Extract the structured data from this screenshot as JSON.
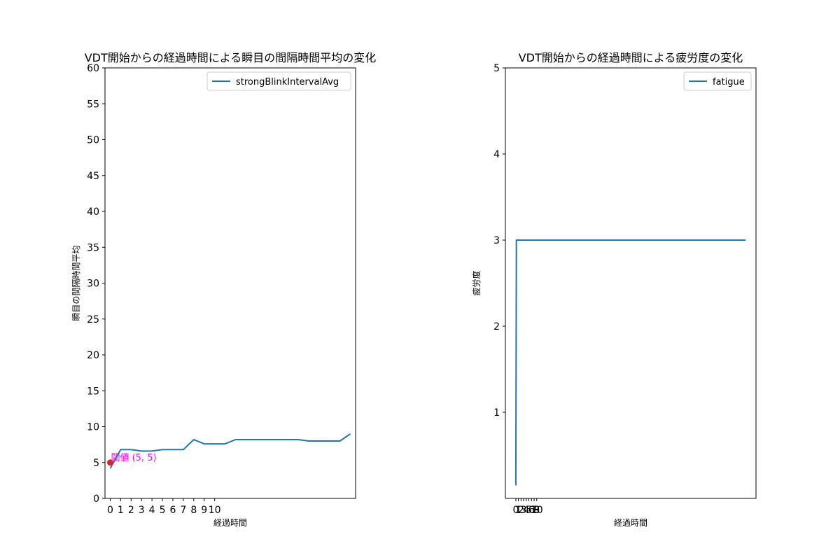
{
  "chart_data": [
    {
      "type": "line",
      "title": "VDT開始からの経過時間による瞬目の間隔時間平均の変化",
      "xlabel": "経過時間",
      "ylabel": "瞬目の間隔時間平均",
      "xlim": [
        -0.5,
        23.5
      ],
      "ylim": [
        0,
        60
      ],
      "yticks": [
        0,
        5,
        10,
        15,
        20,
        25,
        30,
        35,
        40,
        45,
        50,
        55,
        60
      ],
      "xticks": [
        0,
        1,
        2,
        3,
        4,
        5,
        6,
        7,
        8,
        9,
        10
      ],
      "xtick_labels": [
        "0",
        "1",
        "2",
        "3",
        "4",
        "5",
        "6",
        "7",
        "8",
        "9",
        "10"
      ],
      "legend_position": "top-right",
      "grid": false,
      "series": [
        {
          "name": "strongBlinkIntervalAvg",
          "color": "#1f77b4",
          "x": [
            0,
            0.5,
            1,
            2,
            3,
            4,
            5,
            6,
            7,
            8,
            9,
            10,
            11,
            12,
            13,
            14,
            15,
            16,
            17,
            18,
            19,
            20,
            21,
            22,
            23
          ],
          "y": [
            4.2,
            5.5,
            6.8,
            6.8,
            6.6,
            6.6,
            6.8,
            6.8,
            6.8,
            8.2,
            7.6,
            7.6,
            7.6,
            8.2,
            8.2,
            8.2,
            8.2,
            8.2,
            8.2,
            8.2,
            8.0,
            8.0,
            8.0,
            8.0,
            9.0
          ]
        }
      ],
      "annotations": [
        {
          "text": "閾値 (5, 5)",
          "x": 0,
          "y": 5,
          "marker_color": "#d62728",
          "text_color": "#ff00ff"
        }
      ]
    },
    {
      "type": "line",
      "title": "VDT開始からの経過時間による疲労度の変化",
      "xlabel": "経過時間",
      "ylabel": "疲労度",
      "xlim": [
        -1,
        23
      ],
      "ylim": [
        0,
        5
      ],
      "yticks": [
        1,
        2,
        3,
        4,
        5
      ],
      "xticks": [
        0,
        0.25,
        0.5,
        0.75,
        1,
        1.25,
        1.5,
        1.75,
        2
      ],
      "xtick_labels": [
        "0",
        "1",
        "2",
        "3",
        "4",
        "5",
        "6",
        "7",
        "8",
        "9",
        "10"
      ],
      "legend_position": "top-right",
      "grid": false,
      "series": [
        {
          "name": "fatigue",
          "color": "#1f77b4",
          "x": [
            0,
            0.05,
            0.1,
            1,
            2,
            5,
            10,
            15,
            20,
            22
          ],
          "y": [
            0.15,
            3,
            3,
            3,
            3,
            3,
            3,
            3,
            3,
            3
          ]
        }
      ]
    }
  ]
}
